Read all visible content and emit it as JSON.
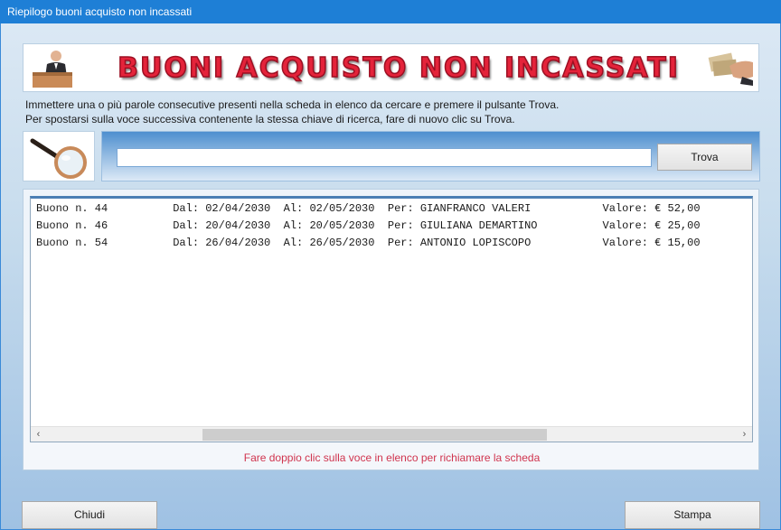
{
  "window": {
    "title": "Riepilogo buoni acquisto non incassati"
  },
  "banner": {
    "title": "BUONI ACQUISTO NON INCASSATI",
    "left_image_icon": "man-at-podium-icon",
    "right_image_icon": "hand-with-banknotes-icon"
  },
  "instructions": {
    "line1": "Immettere una o più parole consecutive presenti nella scheda in elenco da cercare e premere il pulsante Trova.",
    "line2": "Per spostarsi sulla voce successiva contenente la stessa chiave di ricerca, fare di nuovo clic su Trova."
  },
  "search": {
    "icon": "magnifier-icon",
    "value": "",
    "placeholder": "",
    "button_label": "Trova"
  },
  "list": {
    "rows": [
      "Buono n. 44          Dal: 02/04/2030  Al: 02/05/2030  Per: GIANFRANCO VALERI           Valore: € 52,00",
      "Buono n. 46          Dal: 20/04/2030  Al: 20/05/2030  Per: GIULIANA DEMARTINO          Valore: € 25,00",
      "Buono n. 54          Dal: 26/04/2030  Al: 26/05/2030  Per: ANTONIO LOPISCOPO           Valore: € 15,00"
    ],
    "scroll_left_arrow": "‹",
    "scroll_right_arrow": "›"
  },
  "hint": "Fare doppio clic sulla voce in elenco per richiamare la scheda",
  "footer": {
    "close_label": "Chiudi",
    "print_label": "Stampa"
  },
  "colors": {
    "titlebar": "#1e7fd6",
    "banner_text": "#e4233a",
    "hint_text": "#d0344e"
  }
}
